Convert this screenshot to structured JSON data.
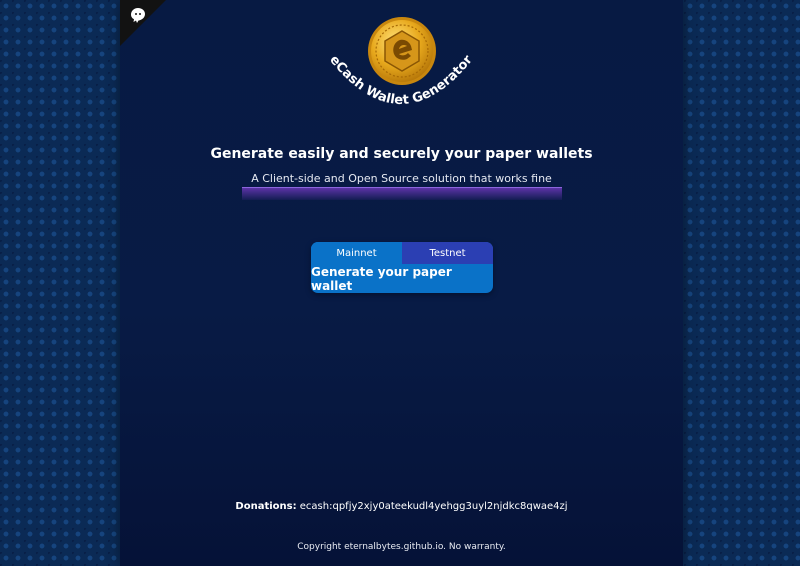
{
  "header": {
    "app_title": "eCash Wallet Generator",
    "logo_icon": "ecash-coin-icon",
    "corner_icon": "octocat-icon"
  },
  "hero": {
    "headline": "Generate easily and securely your paper wallets",
    "subheadline": "A Client-side and Open Source solution that works fine"
  },
  "generator": {
    "tabs": [
      {
        "label": "Mainnet",
        "selected": true
      },
      {
        "label": "Testnet",
        "selected": false
      }
    ],
    "generate_label": "Generate your paper wallet"
  },
  "footer": {
    "donations_label": "Donations:",
    "donations_address": "ecash:qpfjy2xjy0ateekudl4yehgg3uyl2njdkc8qwae4zj",
    "copyright": "Copyright eternalbytes.github.io. No warranty."
  },
  "colors": {
    "background": "#0b2a55",
    "panel": "#071a43",
    "mainnet_tab": "#0a72c8",
    "testnet_tab": "#2b3fb3",
    "coin_gold": "#e0a21b"
  }
}
